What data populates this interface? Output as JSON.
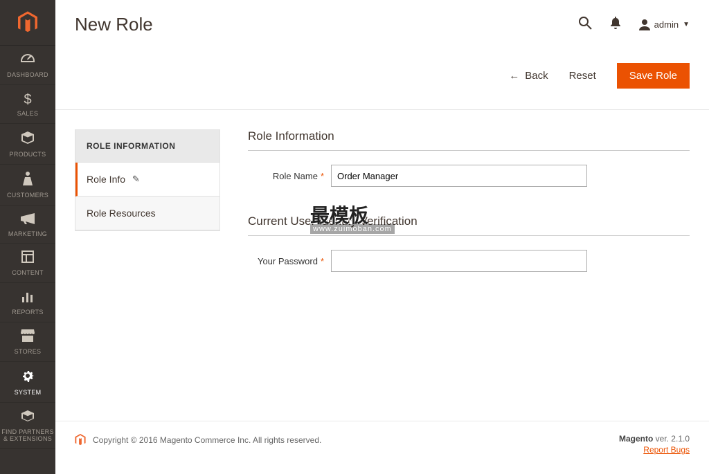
{
  "header": {
    "page_title": "New Role",
    "user_label": "admin"
  },
  "actions": {
    "back_label": "Back",
    "reset_label": "Reset",
    "save_label": "Save Role"
  },
  "sidebar": {
    "items": [
      {
        "label": "Dashboard"
      },
      {
        "label": "Sales"
      },
      {
        "label": "Products"
      },
      {
        "label": "Customers"
      },
      {
        "label": "Marketing"
      },
      {
        "label": "Content"
      },
      {
        "label": "Reports"
      },
      {
        "label": "Stores"
      },
      {
        "label": "System"
      },
      {
        "label": "Find Partners & Extensions"
      }
    ]
  },
  "tabs": {
    "heading": "ROLE INFORMATION",
    "items": [
      {
        "label": "Role Info"
      },
      {
        "label": "Role Resources"
      }
    ]
  },
  "form": {
    "section1_title": "Role Information",
    "role_name_label": "Role Name",
    "role_name_value": "Order Manager",
    "section2_title": "Current User Identity Verification",
    "password_label": "Your Password",
    "password_value": ""
  },
  "watermark": {
    "text": "最模板",
    "sub": "www.zuimoban.com"
  },
  "footer": {
    "copyright": "Copyright © 2016 Magento Commerce Inc. All rights reserved.",
    "brand": "Magento",
    "version": " ver. 2.1.0",
    "report": "Report Bugs"
  }
}
